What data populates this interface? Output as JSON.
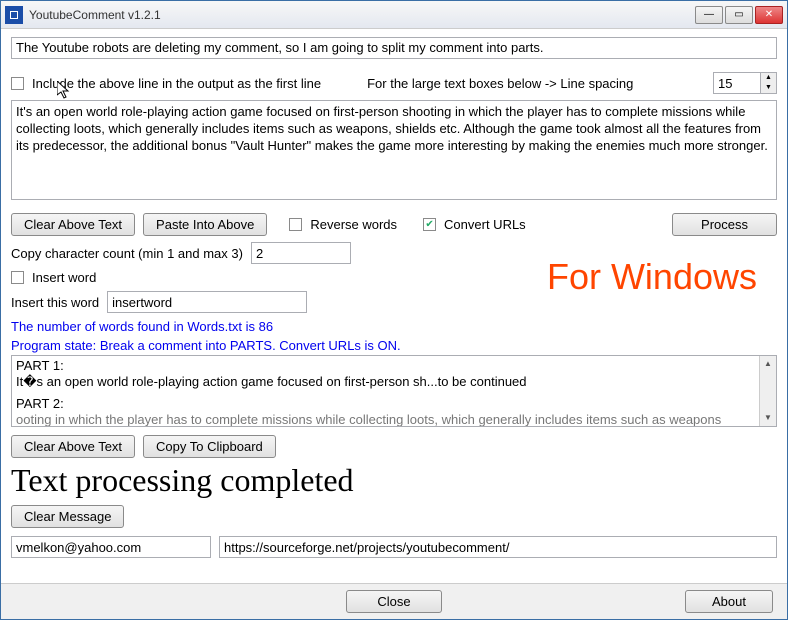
{
  "window": {
    "title": "YoutubeComment v1.2.1"
  },
  "input_top": "The Youtube robots are deleting my comment, so I am going to split my comment into parts.",
  "include_line_label": "Include the above line in the output as the first line",
  "line_spacing_label": "For the large text boxes below -> Line spacing",
  "line_spacing_value": "15",
  "main_text": "It's an open world role-playing action game focused on first-person shooting in which the player has to complete missions while collecting loots, which generally includes items such as weapons, shields etc. Although the game took almost all the features from its predecessor, the additional bonus \"Vault Hunter\" makes the game more interesting by making the enemies much more stronger.",
  "buttons": {
    "clear_above_1": "Clear Above Text",
    "paste_into": "Paste Into Above",
    "process": "Process",
    "clear_above_2": "Clear Above Text",
    "copy_clip": "Copy To Clipboard",
    "clear_message": "Clear Message",
    "close": "Close",
    "about": "About"
  },
  "reverse_words_label": "Reverse words",
  "convert_urls_label": "Convert URLs",
  "copy_count_label": "Copy character count (min 1 and max 3)",
  "copy_count_value": "2",
  "insert_word_check_label": "Insert word",
  "insert_this_word_label": "Insert this word",
  "insert_word_value": "insertword",
  "words_found": "The number of words found in Words.txt is 86",
  "program_state": "Program state: Break a comment into PARTS. Convert URLs is ON.",
  "output": {
    "p1_label": "PART 1:",
    "p1_text": "It�s an open world role-playing action game focused on first-person sh...to be continued",
    "p2_label": "PART 2:",
    "p2_text": "ooting in which the player has to complete missions while collecting loots, which generally includes items such as weapons"
  },
  "status_big": "Text processing completed",
  "email": "vmelkon@yahoo.com",
  "url": "https://sourceforge.net/projects/youtubecomment/",
  "overlay": "For Windows"
}
